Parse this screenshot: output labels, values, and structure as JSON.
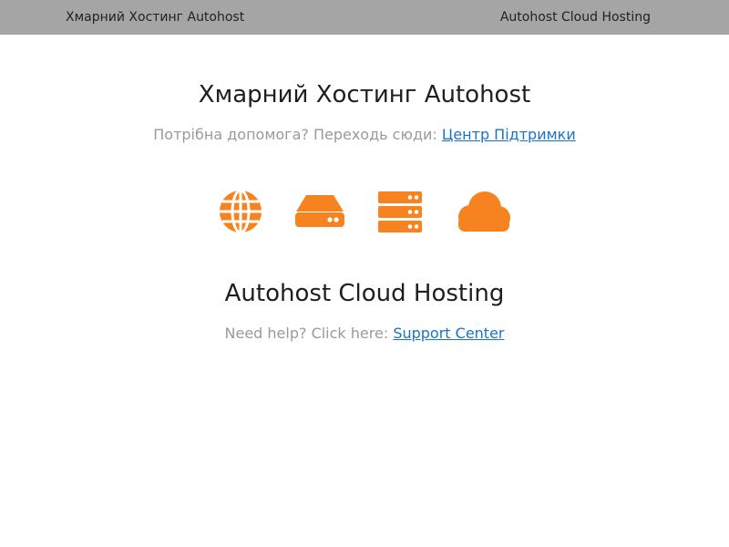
{
  "header": {
    "left_link": "Хмарний Хостинг Autohost",
    "right_link": "Autohost Cloud Hosting"
  },
  "ua": {
    "title": "Хмарний Хостинг Autohost",
    "help_text": "Потрібна допомога? Переходь сюди:",
    "help_link": "Центр Підтримки"
  },
  "icons": [
    "globe-icon",
    "hard-drive-icon",
    "server-rack-icon",
    "cloud-icon"
  ],
  "en": {
    "title": "Autohost Cloud Hosting",
    "help_text": "Need help? Click here:",
    "help_link": "Support Center"
  },
  "colors": {
    "accent": "#f6831f",
    "topbar": "#a5a5a5",
    "link": "#1a73c8",
    "muted_text": "#9a9a9a"
  }
}
